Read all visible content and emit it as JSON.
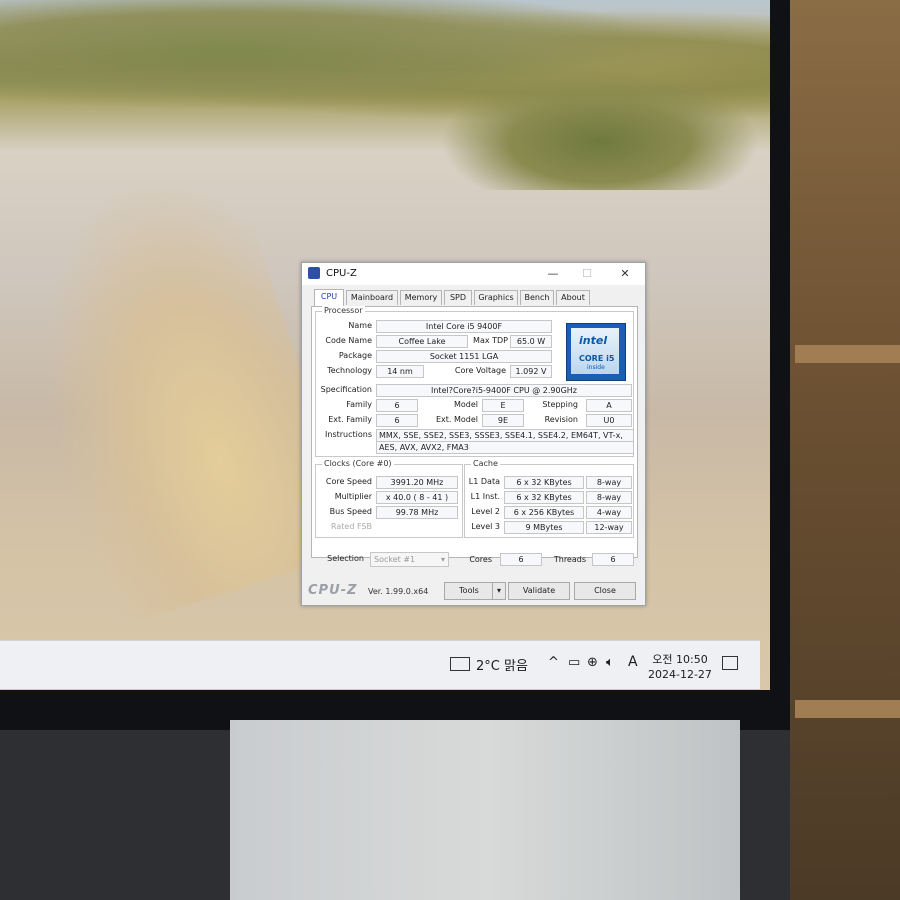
{
  "window": {
    "title": "CPU-Z",
    "min": "—",
    "max": "☐",
    "close": "✕"
  },
  "tabs": [
    "CPU",
    "Mainboard",
    "Memory",
    "SPD",
    "Graphics",
    "Bench",
    "About"
  ],
  "processor": {
    "group_label": "Processor",
    "name_label": "Name",
    "name": "Intel Core i5 9400F",
    "code_label": "Code Name",
    "code": "Coffee Lake",
    "tdp_label": "Max TDP",
    "tdp": "65.0 W",
    "package_label": "Package",
    "package": "Socket 1151 LGA",
    "tech_label": "Technology",
    "tech": "14 nm",
    "voltage_label": "Core Voltage",
    "voltage": "1.092 V",
    "spec_label": "Specification",
    "spec": "Intel?Core?i5-9400F CPU @ 2.90GHz",
    "family_label": "Family",
    "family": "6",
    "model_label": "Model",
    "model": "E",
    "stepping_label": "Stepping",
    "stepping": "A",
    "extfamily_label": "Ext. Family",
    "extfamily": "6",
    "extmodel_label": "Ext. Model",
    "extmodel": "9E",
    "revision_label": "Revision",
    "revision": "U0",
    "instr_label": "Instructions",
    "instr1": "MMX, SSE, SSE2, SSE3, SSSE3, SSE4.1, SSE4.2, EM64T, VT-x,",
    "instr2": "AES, AVX, AVX2, FMA3",
    "intel_line1": "intel",
    "intel_line2": "CORE i5",
    "intel_line3": "inside"
  },
  "clocks": {
    "group_label": "Clocks (Core #0)",
    "speed_label": "Core Speed",
    "speed": "3991.20 MHz",
    "mult_label": "Multiplier",
    "mult": "x 40.0 ( 8 - 41 )",
    "bus_label": "Bus Speed",
    "bus": "99.78 MHz",
    "fsb_label": "Rated FSB"
  },
  "cache": {
    "group_label": "Cache",
    "l1d_label": "L1 Data",
    "l1d": "6 x 32 KBytes",
    "l1d_way": "8-way",
    "l1i_label": "L1 Inst.",
    "l1i": "6 x 32 KBytes",
    "l1i_way": "8-way",
    "l2_label": "Level 2",
    "l2": "6 x 256 KBytes",
    "l2_way": "4-way",
    "l3_label": "Level 3",
    "l3": "9 MBytes",
    "l3_way": "12-way"
  },
  "selection": {
    "label": "Selection",
    "value": "Socket #1",
    "cores_label": "Cores",
    "cores": "6",
    "threads_label": "Threads",
    "threads": "6"
  },
  "footer": {
    "logo": "CPU-Z",
    "version": "Ver. 1.99.0.x64",
    "tools": "Tools",
    "validate": "Validate",
    "close": "Close"
  },
  "taskbar": {
    "weather": "2°C  맑음",
    "ime": "A",
    "time": "오전 10:50",
    "date": "2024-12-27"
  }
}
